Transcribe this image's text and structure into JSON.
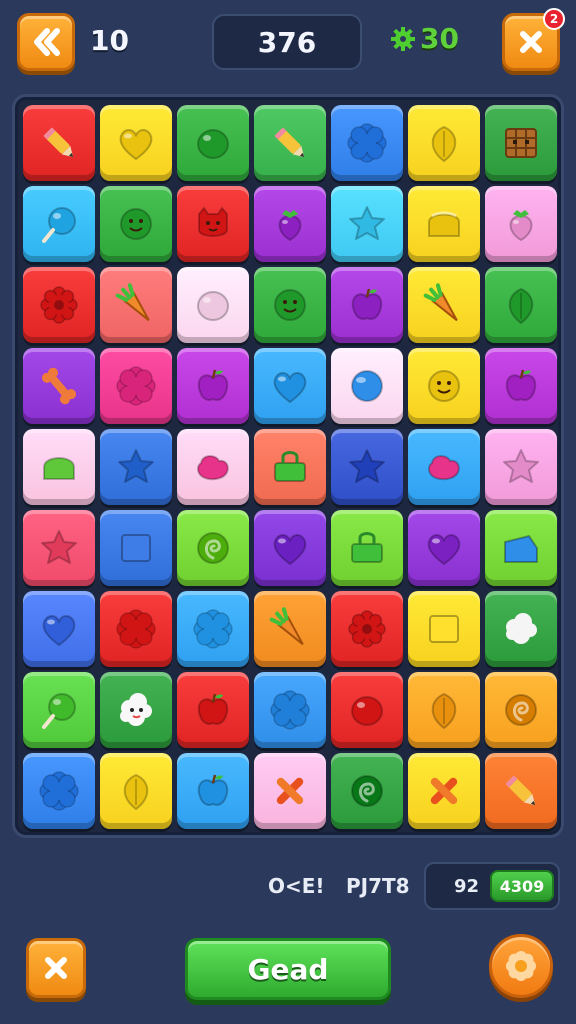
{
  "header": {
    "moves": "10",
    "score": "376",
    "coins": "30",
    "notification_count": "2"
  },
  "board": {
    "rows": [
      [
        [
          "#e02424",
          "pencil-icon"
        ],
        [
          "#f7d11e",
          "heart-icon"
        ],
        [
          "#2fa83a",
          "lemon-icon"
        ],
        [
          "#36b04a",
          "pencil-icon"
        ],
        [
          "#2f7ee8",
          "flower-icon"
        ],
        [
          "#f7d11e",
          "leaf-icon"
        ],
        [
          "#2b9a3a",
          "crate-icon"
        ]
      ],
      [
        [
          "#2fb3f0",
          "lollipop-icon"
        ],
        [
          "#2fa83a",
          "smiley-icon"
        ],
        [
          "#e02424",
          "cat-face-icon"
        ],
        [
          "#9b2fd0",
          "strawberry-icon"
        ],
        [
          "#3fc8f2",
          "star-icon"
        ],
        [
          "#f7d11e",
          "cake-icon"
        ],
        [
          "#f29ad8",
          "strawberry-icon"
        ]
      ],
      [
        [
          "#e02424",
          "gear-icon"
        ],
        [
          "#f06464",
          "carrot-icon"
        ],
        [
          "#fbd6ee",
          "lemon-icon"
        ],
        [
          "#2fa83a",
          "smiley-icon"
        ],
        [
          "#9b2fd0",
          "apple-icon"
        ],
        [
          "#f7d11e",
          "carrot-icon"
        ],
        [
          "#2fa83a",
          "leaf-icon"
        ]
      ],
      [
        [
          "#8a2fd0",
          "bone-icon"
        ],
        [
          "#e8338a",
          "flower-icon"
        ],
        [
          "#b02fd0",
          "apple-icon"
        ],
        [
          "#2fa0f0",
          "heart-icon"
        ],
        [
          "#fbd6ee",
          "orb-icon"
        ],
        [
          "#f7d11e",
          "smiley-icon"
        ],
        [
          "#b02fd0",
          "apple-icon"
        ]
      ],
      [
        [
          "#f9c3df",
          "dome-icon"
        ],
        [
          "#2f6ed8",
          "star-icon"
        ],
        [
          "#f9c3df",
          "blob-icon"
        ],
        [
          "#f06a50",
          "bag-icon"
        ],
        [
          "#2f4fc8",
          "star-icon"
        ],
        [
          "#2fa0f0",
          "blob-icon"
        ],
        [
          "#f29ad8",
          "star-icon"
        ]
      ],
      [
        [
          "#f04a6a",
          "star-icon"
        ],
        [
          "#2f6ed8",
          "square-icon"
        ],
        [
          "#6fd02f",
          "swirl-icon"
        ],
        [
          "#7a2fd0",
          "heart-icon"
        ],
        [
          "#6fd02f",
          "bag-icon"
        ],
        [
          "#8a2fd0",
          "heart-icon"
        ],
        [
          "#6fd02f",
          "ticket-icon"
        ]
      ],
      [
        [
          "#3f6ee8",
          "heart-icon"
        ],
        [
          "#e02424",
          "flower-icon"
        ],
        [
          "#2fa0f0",
          "flower-icon"
        ],
        [
          "#f08a1e",
          "carrot-icon"
        ],
        [
          "#e02424",
          "gear-icon"
        ],
        [
          "#f7d11e",
          "square-icon"
        ],
        [
          "#2b9a3a",
          "cloud-icon"
        ]
      ],
      [
        [
          "#4fc83a",
          "lollipop-icon"
        ],
        [
          "#2b9a3a",
          "ghost-icon"
        ],
        [
          "#e02424",
          "apple-icon"
        ],
        [
          "#2f8ee8",
          "flower-icon"
        ],
        [
          "#e02424",
          "lemon-icon"
        ],
        [
          "#f7a01e",
          "leaf-icon"
        ],
        [
          "#f7a01e",
          "swirl-icon"
        ]
      ],
      [
        [
          "#2f7ee8",
          "flower-icon"
        ],
        [
          "#f7d11e",
          "leaf-icon"
        ],
        [
          "#2fa0f0",
          "apple-icon"
        ],
        [
          "#f9b3dc",
          "cross-icon"
        ],
        [
          "#2b9a3a",
          "swirl-icon"
        ],
        [
          "#f7d11e",
          "cross-icon"
        ],
        [
          "#f06a1e",
          "pencil-icon"
        ]
      ]
    ]
  },
  "footer": {
    "stat_a": "O<E!",
    "stat_b": "PJ7T8",
    "stat_c": "92",
    "stat_pill": "4309",
    "main_button": "Gead"
  },
  "colors": {
    "orange_button": "#f7a01e",
    "green_button": "#2faa2f",
    "background": "#2b3a5c"
  }
}
